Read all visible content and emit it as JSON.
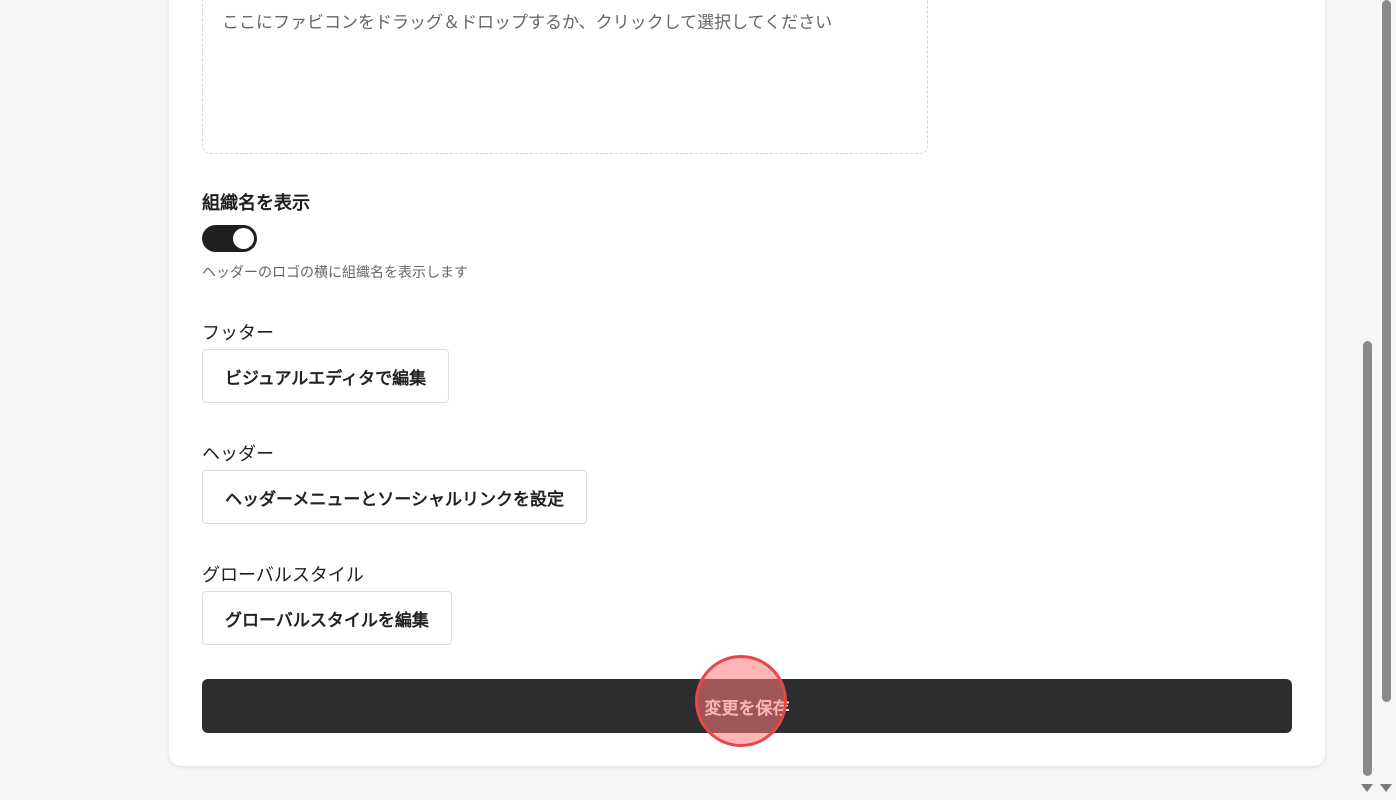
{
  "dropzone": {
    "text": "ここにファビコンをドラッグ＆ドロップするか、クリックして選択してください"
  },
  "org_name": {
    "label": "組織名を表示",
    "enabled": true,
    "help": "ヘッダーのロゴの横に組織名を表示します"
  },
  "footer": {
    "label": "フッター",
    "button": "ビジュアルエディタで編集"
  },
  "header": {
    "label": "ヘッダー",
    "button": "ヘッダーメニューとソーシャルリンクを設定"
  },
  "global_style": {
    "label": "グローバルスタイル",
    "button": "グローバルスタイルを編集"
  },
  "save": {
    "label": "変更を保存"
  }
}
